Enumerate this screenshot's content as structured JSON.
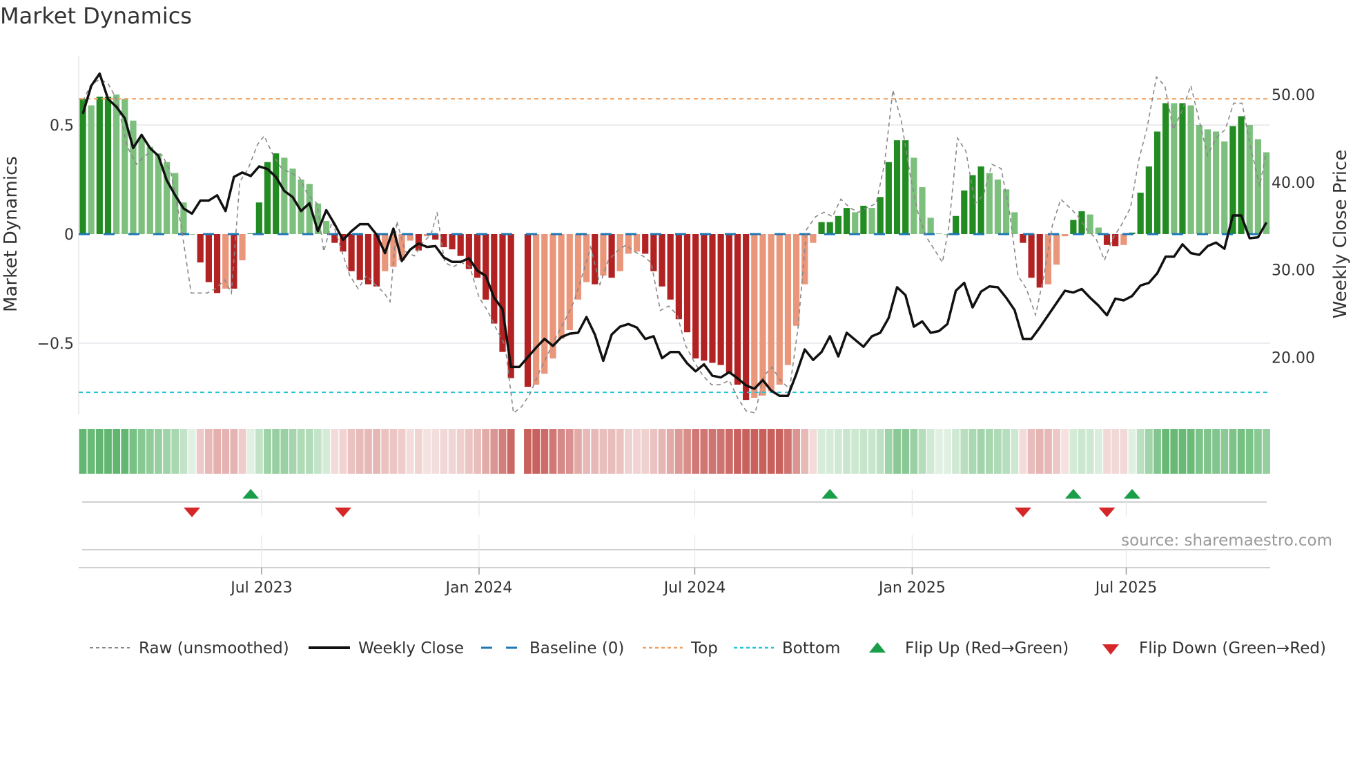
{
  "title": "Market Dynamics",
  "source": "source: sharemaestro.com",
  "colors": {
    "bar_up_strong": "#228B22",
    "bar_up_weak": "#7DBF7D",
    "bar_down_strong": "#B22222",
    "bar_down_weak": "#E9967A",
    "close": "#111111",
    "raw": "#888888",
    "baseline": "#1F77B4",
    "top": "#F0A060",
    "bottom": "#22C3D6",
    "flip_up": "#1A9E4A",
    "flip_down": "#D62728"
  },
  "legend": {
    "raw": "Raw (unsmoothed)",
    "close": "Weekly Close",
    "baseline": "Baseline (0)",
    "top": "Top",
    "bottom": "Bottom",
    "flip_up": "Flip Up (Red→Green)",
    "flip_down": "Flip Down (Green→Red)"
  },
  "chart_data": {
    "type": "bar",
    "title": "Market Dynamics",
    "ylabel": "Market Dynamics",
    "ylabel_right": "Weekly Close Price",
    "ylim": [
      -0.83,
      0.82
    ],
    "ylim_right": [
      13.6,
      55.8
    ],
    "yticks": [
      {
        "v": 0.5,
        "label": "0.5"
      },
      {
        "v": 0,
        "label": "0"
      },
      {
        "v": -0.5,
        "label": "−0.5"
      }
    ],
    "yticks_right": [
      {
        "v": 50,
        "label": "50.00"
      },
      {
        "v": 40,
        "label": "40.00"
      },
      {
        "v": 30,
        "label": "30.00"
      },
      {
        "v": 20,
        "label": "20.00"
      }
    ],
    "xticks": [
      {
        "week": 21.3,
        "label": "Jul 2023"
      },
      {
        "week": 47.2,
        "label": "Jan 2024"
      },
      {
        "week": 72.9,
        "label": "Jul 2024"
      },
      {
        "week": 98.8,
        "label": "Jan 2025"
      },
      {
        "week": 124.3,
        "label": "Jul 2025"
      }
    ],
    "levels": {
      "top": 0.62,
      "bottom": -0.725,
      "baseline": 0
    },
    "bars": [
      [
        0.62,
        "d"
      ],
      [
        0.59,
        "l"
      ],
      [
        0.63,
        "d"
      ],
      [
        0.63,
        "d"
      ],
      [
        0.64,
        "l"
      ],
      [
        0.62,
        "l"
      ],
      [
        0.52,
        "l"
      ],
      [
        0.44,
        "l"
      ],
      [
        0.4,
        "l"
      ],
      [
        0.37,
        "l"
      ],
      [
        0.33,
        "l"
      ],
      [
        0.28,
        "l"
      ],
      [
        0.145,
        "l"
      ],
      [
        0.0,
        "l"
      ],
      [
        -0.13,
        "d"
      ],
      [
        -0.22,
        "d"
      ],
      [
        -0.27,
        "d"
      ],
      [
        -0.25,
        "l"
      ],
      [
        -0.25,
        "d"
      ],
      [
        -0.12,
        "l"
      ],
      [
        0.003,
        "d"
      ],
      [
        0.145,
        "d"
      ],
      [
        0.33,
        "d"
      ],
      [
        0.37,
        "d"
      ],
      [
        0.35,
        "l"
      ],
      [
        0.3,
        "l"
      ],
      [
        0.25,
        "l"
      ],
      [
        0.23,
        "l"
      ],
      [
        0.14,
        "l"
      ],
      [
        0.06,
        "l"
      ],
      [
        -0.04,
        "d"
      ],
      [
        -0.08,
        "d"
      ],
      [
        -0.17,
        "d"
      ],
      [
        -0.21,
        "d"
      ],
      [
        -0.23,
        "d"
      ],
      [
        -0.24,
        "d"
      ],
      [
        -0.17,
        "l"
      ],
      [
        -0.15,
        "l"
      ],
      [
        -0.12,
        "l"
      ],
      [
        -0.03,
        "l"
      ],
      [
        -0.075,
        "d"
      ],
      [
        -0.01,
        "l"
      ],
      [
        -0.025,
        "d"
      ],
      [
        -0.06,
        "d"
      ],
      [
        -0.07,
        "d"
      ],
      [
        -0.1,
        "d"
      ],
      [
        -0.16,
        "d"
      ],
      [
        -0.2,
        "d"
      ],
      [
        -0.3,
        "d"
      ],
      [
        -0.41,
        "d"
      ],
      [
        -0.54,
        "d"
      ],
      [
        -0.66,
        "d"
      ],
      null,
      [
        -0.7,
        "d"
      ],
      [
        -0.69,
        "l"
      ],
      [
        -0.64,
        "l"
      ],
      [
        -0.57,
        "l"
      ],
      [
        -0.48,
        "l"
      ],
      [
        -0.44,
        "l"
      ],
      [
        -0.3,
        "l"
      ],
      [
        -0.22,
        "l"
      ],
      [
        -0.23,
        "d"
      ],
      [
        -0.19,
        "l"
      ],
      [
        -0.2,
        "d"
      ],
      [
        -0.17,
        "l"
      ],
      [
        -0.09,
        "l"
      ],
      [
        -0.08,
        "l"
      ],
      [
        -0.09,
        "d"
      ],
      [
        -0.17,
        "d"
      ],
      [
        -0.24,
        "d"
      ],
      [
        -0.3,
        "d"
      ],
      [
        -0.39,
        "d"
      ],
      [
        -0.45,
        "d"
      ],
      [
        -0.57,
        "d"
      ],
      [
        -0.58,
        "d"
      ],
      [
        -0.59,
        "d"
      ],
      [
        -0.6,
        "d"
      ],
      [
        -0.64,
        "d"
      ],
      [
        -0.69,
        "d"
      ],
      [
        -0.76,
        "d"
      ],
      [
        -0.75,
        "l"
      ],
      [
        -0.74,
        "l"
      ],
      [
        -0.72,
        "l"
      ],
      [
        -0.69,
        "l"
      ],
      [
        -0.6,
        "l"
      ],
      [
        -0.42,
        "l"
      ],
      [
        -0.23,
        "l"
      ],
      [
        -0.04,
        "l"
      ],
      [
        0.055,
        "d"
      ],
      [
        0.055,
        "d"
      ],
      [
        0.083,
        "d"
      ],
      [
        0.12,
        "d"
      ],
      [
        0.1,
        "l"
      ],
      [
        0.13,
        "d"
      ],
      [
        0.12,
        "l"
      ],
      [
        0.17,
        "d"
      ],
      [
        0.33,
        "d"
      ],
      [
        0.43,
        "d"
      ],
      [
        0.43,
        "d"
      ],
      [
        0.35,
        "l"
      ],
      [
        0.215,
        "l"
      ],
      [
        0.075,
        "l"
      ],
      [
        0.003,
        "l"
      ],
      [
        0.0,
        "l"
      ],
      [
        0.083,
        "d"
      ],
      [
        0.2,
        "d"
      ],
      [
        0.27,
        "d"
      ],
      [
        0.31,
        "d"
      ],
      [
        0.28,
        "l"
      ],
      [
        0.25,
        "l"
      ],
      [
        0.205,
        "l"
      ],
      [
        0.1,
        "l"
      ],
      [
        -0.04,
        "d"
      ],
      [
        -0.2,
        "d"
      ],
      [
        -0.245,
        "d"
      ],
      [
        -0.23,
        "l"
      ],
      [
        -0.14,
        "l"
      ],
      [
        -0.01,
        "l"
      ],
      [
        0.065,
        "d"
      ],
      [
        0.105,
        "d"
      ],
      [
        0.09,
        "l"
      ],
      [
        0.03,
        "l"
      ],
      [
        -0.05,
        "d"
      ],
      [
        -0.055,
        "d"
      ],
      [
        -0.05,
        "l"
      ],
      [
        0.007,
        "d"
      ],
      [
        0.19,
        "d"
      ],
      [
        0.31,
        "d"
      ],
      [
        0.47,
        "d"
      ],
      [
        0.6,
        "d"
      ],
      [
        0.6,
        "l"
      ],
      [
        0.6,
        "d"
      ],
      [
        0.59,
        "l"
      ],
      [
        0.5,
        "l"
      ],
      [
        0.48,
        "l"
      ],
      [
        0.47,
        "l"
      ],
      [
        0.425,
        "l"
      ],
      [
        0.495,
        "d"
      ],
      [
        0.54,
        "d"
      ],
      [
        0.5,
        "l"
      ],
      [
        0.435,
        "l"
      ],
      [
        0.375,
        "l"
      ]
    ],
    "close": [
      47.8,
      51.0,
      52.4,
      49.5,
      48.6,
      47.3,
      43.9,
      45.4,
      43.9,
      43.0,
      40.2,
      38.5,
      37.0,
      36.4,
      37.9,
      37.9,
      38.5,
      36.7,
      40.6,
      41.1,
      40.7,
      41.8,
      41.5,
      40.6,
      39.0,
      38.3,
      36.7,
      37.6,
      34.4,
      36.8,
      35.2,
      33.4,
      34.4,
      35.2,
      35.2,
      34.0,
      31.9,
      34.7,
      31.0,
      32.3,
      33.0,
      32.6,
      32.7,
      31.4,
      30.9,
      30.9,
      31.3,
      29.9,
      29.3,
      26.8,
      25.5,
      18.9,
      18.9,
      20.0,
      21.1,
      22.1,
      21.3,
      22.3,
      22.7,
      22.8,
      24.6,
      22.6,
      19.6,
      22.6,
      23.5,
      23.8,
      23.4,
      22.1,
      22.4,
      19.9,
      20.6,
      20.6,
      19.3,
      18.4,
      19.2,
      17.9,
      17.7,
      18.3,
      17.6,
      16.8,
      16.4,
      17.4,
      16.2,
      15.6,
      15.6,
      18.1,
      20.9,
      19.7,
      20.6,
      22.4,
      20.1,
      22.8,
      22.0,
      21.2,
      22.4,
      22.8,
      24.5,
      28.0,
      27.1,
      23.5,
      24.1,
      22.8,
      23.0,
      23.8,
      27.6,
      28.5,
      25.7,
      27.5,
      28.1,
      28.0,
      26.8,
      25.4,
      22.1,
      22.1,
      23.4,
      24.8,
      26.2,
      27.6,
      27.4,
      27.8,
      26.8,
      25.9,
      24.8,
      26.7,
      26.5,
      27.0,
      28.2,
      28.5,
      29.6,
      31.5,
      31.5,
      32.9,
      31.9,
      31.7,
      32.7,
      33.1,
      32.4,
      36.2,
      36.2,
      33.6,
      33.7,
      35.4
    ],
    "raw": [
      [
        0,
        0.61
      ],
      [
        0.9,
        0.68
      ],
      [
        2.0,
        0.71
      ],
      [
        3.0,
        0.69
      ],
      [
        4.0,
        0.62
      ],
      [
        5.3,
        0.4
      ],
      [
        6.4,
        0.32
      ],
      [
        7.4,
        0.36
      ],
      [
        8.4,
        0.38
      ],
      [
        9.5,
        0.36
      ],
      [
        10.5,
        0.28
      ],
      [
        11.7,
        0.04
      ],
      [
        12.9,
        -0.27
      ],
      [
        14.8,
        -0.27
      ],
      [
        15.8,
        -0.25
      ],
      [
        16.9,
        -0.21
      ],
      [
        17.7,
        -0.27
      ],
      [
        18.7,
        0.24
      ],
      [
        19.7,
        0.3
      ],
      [
        20.8,
        0.41
      ],
      [
        21.6,
        0.45
      ],
      [
        22.7,
        0.36
      ],
      [
        23.7,
        0.3
      ],
      [
        24.8,
        0.28
      ],
      [
        25.8,
        0.26
      ],
      [
        26.8,
        0.18
      ],
      [
        27.9,
        0.14
      ],
      [
        28.7,
        -0.08
      ],
      [
        29.7,
        0.06
      ],
      [
        30.7,
        -0.06
      ],
      [
        31.8,
        -0.19
      ],
      [
        32.8,
        -0.25
      ],
      [
        33.8,
        -0.19
      ],
      [
        34.8,
        -0.23
      ],
      [
        35.9,
        -0.27
      ],
      [
        36.6,
        -0.31
      ],
      [
        37.4,
        0.06
      ],
      [
        38.4,
        -0.08
      ],
      [
        39.5,
        -0.1
      ],
      [
        40.5,
        -0.04
      ],
      [
        41.5,
        0.0
      ],
      [
        42.2,
        0.1
      ],
      [
        43.1,
        -0.13
      ],
      [
        44.1,
        -0.15
      ],
      [
        45.1,
        -0.13
      ],
      [
        46.1,
        -0.15
      ],
      [
        47.2,
        -0.29
      ],
      [
        48.2,
        -0.35
      ],
      [
        49.2,
        -0.43
      ],
      [
        50.3,
        -0.51
      ],
      [
        51.3,
        -0.82
      ],
      [
        52.3,
        -0.79
      ],
      [
        53.3,
        -0.73
      ],
      [
        54.4,
        -0.63
      ],
      [
        55.4,
        -0.55
      ],
      [
        56.4,
        -0.47
      ],
      [
        57.5,
        -0.39
      ],
      [
        58.5,
        -0.31
      ],
      [
        59.5,
        -0.19
      ],
      [
        60.5,
        -0.06
      ],
      [
        61.6,
        -0.23
      ],
      [
        62.6,
        -0.12
      ],
      [
        63.6,
        -0.08
      ],
      [
        64.7,
        -0.05
      ],
      [
        65.7,
        -0.08
      ],
      [
        66.7,
        -0.1
      ],
      [
        67.7,
        -0.13
      ],
      [
        68.8,
        -0.35
      ],
      [
        69.8,
        -0.33
      ],
      [
        70.8,
        -0.37
      ],
      [
        71.8,
        -0.51
      ],
      [
        72.9,
        -0.59
      ],
      [
        73.9,
        -0.65
      ],
      [
        74.9,
        -0.69
      ],
      [
        76.0,
        -0.69
      ],
      [
        77.0,
        -0.67
      ],
      [
        78.0,
        -0.75
      ],
      [
        79.0,
        -0.81
      ],
      [
        80.1,
        -0.82
      ],
      [
        81.1,
        -0.65
      ],
      [
        82.1,
        -0.61
      ],
      [
        83.1,
        -0.67
      ],
      [
        84.2,
        -0.71
      ],
      [
        85.2,
        -0.43
      ],
      [
        86.2,
        0.02
      ],
      [
        87.3,
        0.08
      ],
      [
        88.3,
        0.1
      ],
      [
        89.3,
        0.08
      ],
      [
        90.3,
        0.16
      ],
      [
        91.4,
        0.12
      ],
      [
        92.4,
        0.1
      ],
      [
        93.4,
        0.12
      ],
      [
        94.5,
        0.14
      ],
      [
        95.5,
        0.32
      ],
      [
        96.5,
        0.66
      ],
      [
        97.5,
        0.52
      ],
      [
        98.6,
        0.26
      ],
      [
        99.6,
        0.08
      ],
      [
        100.6,
        -0.02
      ],
      [
        101.6,
        -0.08
      ],
      [
        102.4,
        -0.13
      ],
      [
        103.2,
        0.04
      ],
      [
        104.2,
        0.44
      ],
      [
        105.2,
        0.38
      ],
      [
        106.3,
        0.14
      ],
      [
        107.3,
        0.18
      ],
      [
        108.3,
        0.32
      ],
      [
        109.4,
        0.3
      ],
      [
        110.4,
        0.1
      ],
      [
        111.4,
        -0.19
      ],
      [
        112.4,
        -0.25
      ],
      [
        113.5,
        -0.37
      ],
      [
        114.5,
        -0.19
      ],
      [
        115.5,
        0.04
      ],
      [
        116.5,
        0.16
      ],
      [
        117.6,
        0.12
      ],
      [
        118.6,
        0.08
      ],
      [
        119.6,
        0.02
      ],
      [
        120.7,
        -0.02
      ],
      [
        121.7,
        -0.12
      ],
      [
        122.7,
        -0.02
      ],
      [
        123.7,
        0.04
      ],
      [
        124.8,
        0.12
      ],
      [
        125.8,
        0.34
      ],
      [
        126.8,
        0.49
      ],
      [
        127.9,
        0.72
      ],
      [
        128.9,
        0.68
      ],
      [
        129.9,
        0.48
      ],
      [
        130.9,
        0.56
      ],
      [
        132.0,
        0.68
      ],
      [
        133.0,
        0.52
      ],
      [
        134.0,
        0.36
      ],
      [
        135.0,
        0.44
      ],
      [
        136.1,
        0.48
      ],
      [
        137.1,
        0.6
      ],
      [
        138.1,
        0.6
      ],
      [
        139.1,
        0.4
      ],
      [
        140.2,
        0.22
      ],
      [
        140.9,
        0.36
      ]
    ],
    "flip_up_weeks": [
      20,
      89,
      118,
      125
    ],
    "flip_down_weeks": [
      13,
      31,
      112,
      122
    ],
    "grid": true,
    "legend_position": "bottom"
  }
}
